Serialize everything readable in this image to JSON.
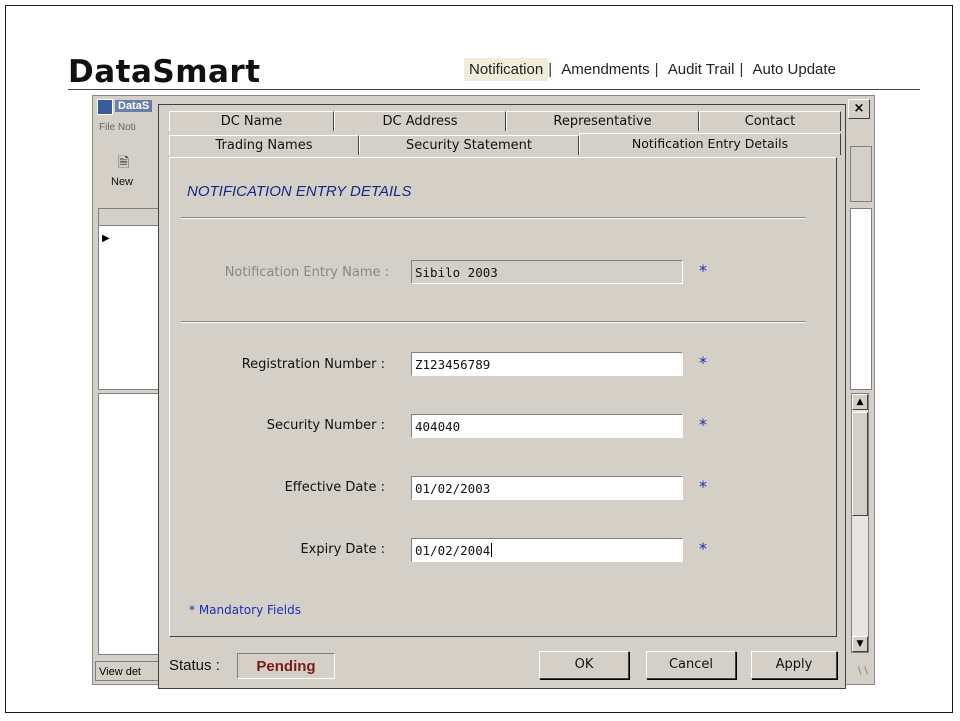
{
  "brand": "DataSmart",
  "topnav": {
    "items": [
      "Notification",
      "Amendments",
      "Audit Trail",
      "Auto Update"
    ],
    "separator": "|"
  },
  "background_window": {
    "title": "DataS",
    "menu": "File  Noti",
    "toolbar_new": "New",
    "status": "View det",
    "close_glyph": "×"
  },
  "dialog": {
    "tabs_row1": [
      "DC Name",
      "DC Address",
      "Representative",
      "Contact"
    ],
    "tabs_row2": [
      "Trading Names",
      "Security Statement",
      "Notification Entry Details"
    ],
    "active_tab": "Notification Entry Details",
    "section_title": "NOTIFICATION ENTRY DETAILS",
    "fields": {
      "entry_name": {
        "label": "Notification Entry Name :",
        "value": "Sibilo 2003"
      },
      "registration_number": {
        "label": "Registration Number :",
        "value": "Z123456789"
      },
      "security_number": {
        "label": "Security Number :",
        "value": "404040"
      },
      "effective_date": {
        "label": "Effective Date :",
        "value": "01/02/2003"
      },
      "expiry_date": {
        "label": "Expiry Date :",
        "value": "01/02/2004"
      }
    },
    "required_marker": "*",
    "mandatory_note": "* Mandatory Fields",
    "status_label": "Status :",
    "status_value": "Pending",
    "buttons": {
      "ok": "OK",
      "cancel": "Cancel",
      "apply": "Apply"
    }
  },
  "colors": {
    "window_bg": "#d4d0c8",
    "accent_blue": "#1c2fb3",
    "status_text": "#7a1a1a",
    "nav_highlight": "#efecd9"
  }
}
